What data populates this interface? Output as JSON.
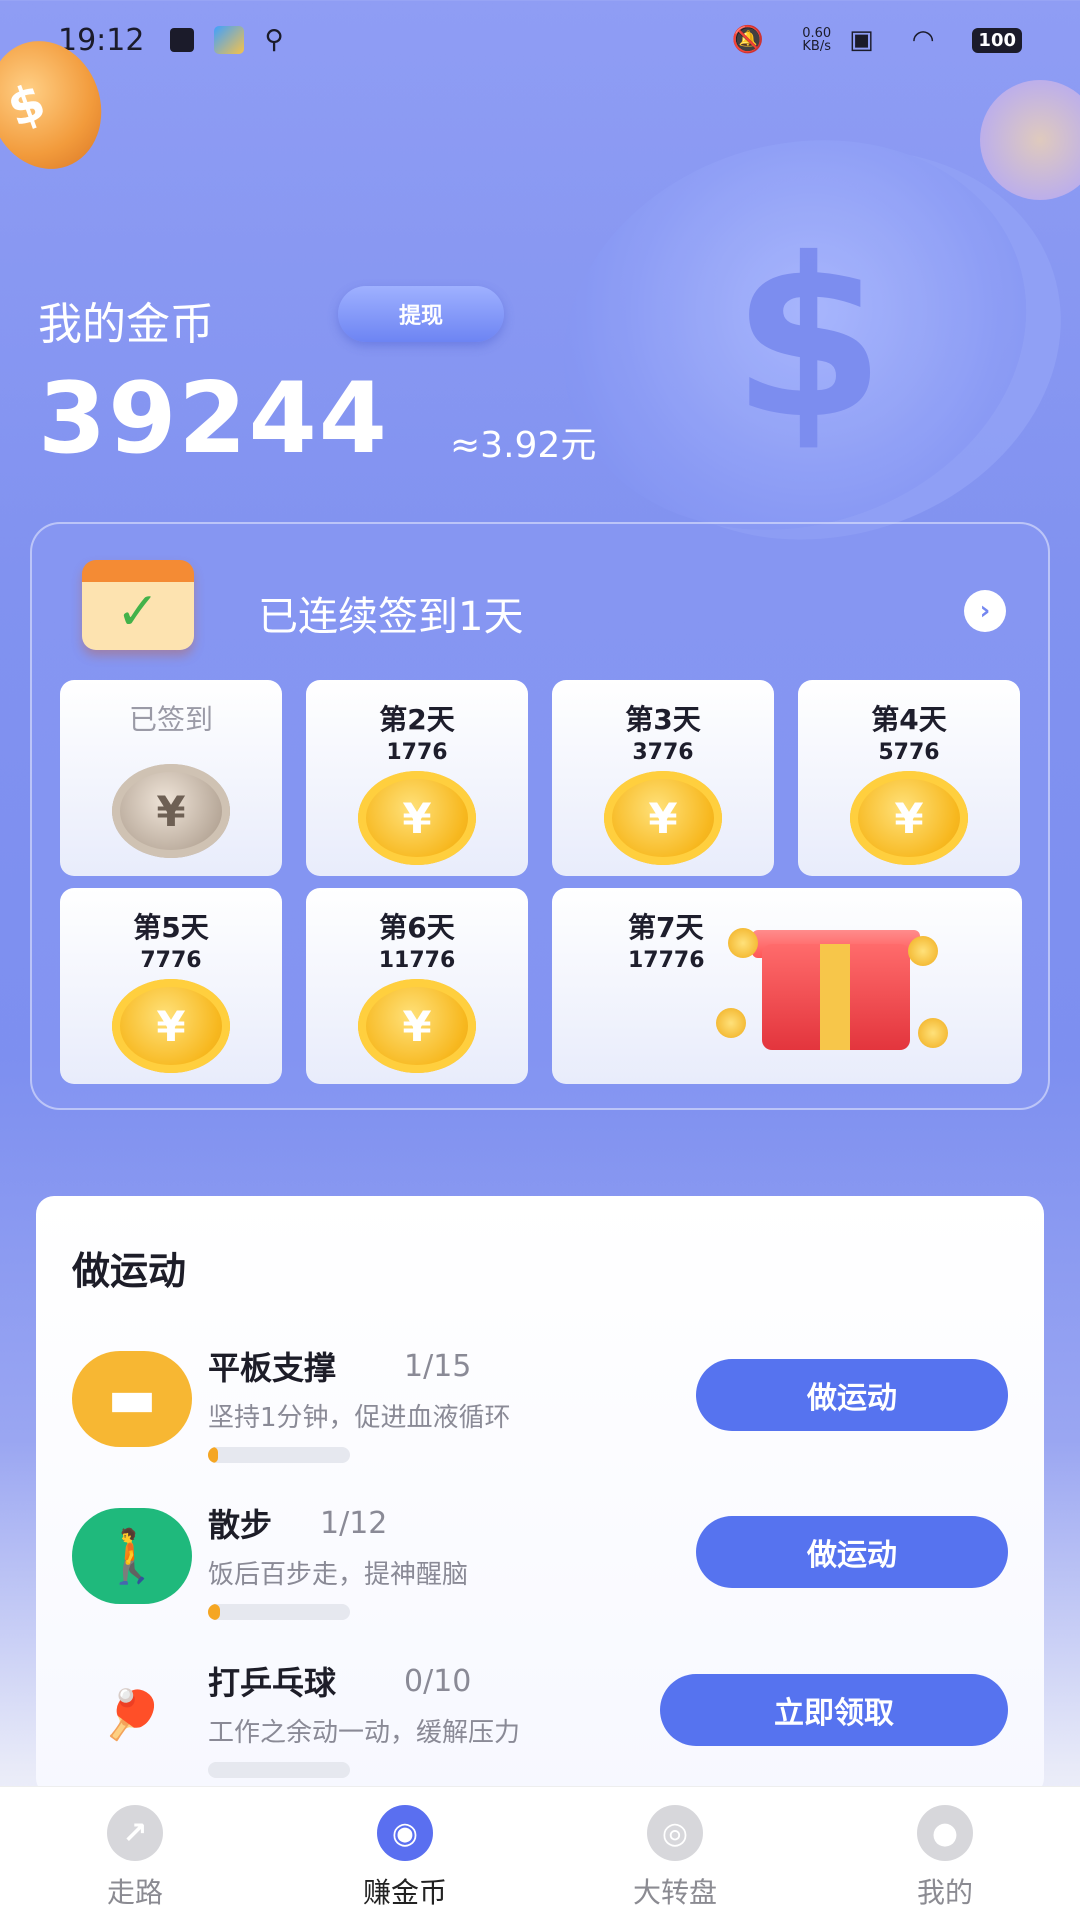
{
  "status_bar": {
    "time": "19:12",
    "net_speed_value": "0.60",
    "net_speed_unit": "KB/s",
    "battery": "100"
  },
  "header": {
    "coin_title": "我的金币",
    "withdraw_label": "提现",
    "coin_amount": "39244",
    "coin_value": "≈3.92元"
  },
  "signin": {
    "streak_text": "已连续签到1天",
    "days": [
      {
        "label": "已签到",
        "reward": "",
        "state": "done"
      },
      {
        "label": "第2天",
        "reward": "1776",
        "state": "pending"
      },
      {
        "label": "第3天",
        "reward": "3776",
        "state": "pending"
      },
      {
        "label": "第4天",
        "reward": "5776",
        "state": "pending"
      },
      {
        "label": "第5天",
        "reward": "7776",
        "state": "pending"
      },
      {
        "label": "第6天",
        "reward": "11776",
        "state": "pending"
      },
      {
        "label": "第7天",
        "reward": "17776",
        "state": "pending"
      }
    ],
    "coin_symbol": "¥"
  },
  "exercise": {
    "title": "做运动",
    "items": [
      {
        "name": "平板支撑",
        "count": "1/15",
        "desc": "坚持1分钟，促进血液循环",
        "button": "做运动",
        "progress": 0.067,
        "icon": "plank-icon",
        "color": "#f7b733"
      },
      {
        "name": "散步",
        "count": "1/12",
        "desc": "饭后百步走，提神醒脑",
        "button": "做运动",
        "progress": 0.083,
        "icon": "walking-icon",
        "color": "#1fb97c"
      },
      {
        "name": "打乒乓球",
        "count": "0/10",
        "desc": "工作之余动一动，缓解压力",
        "button": "立即领取",
        "progress": 0,
        "icon": "ping-pong-icon",
        "color": "#5673ef"
      }
    ]
  },
  "bottom_nav": {
    "items": [
      {
        "label": "走路",
        "icon": "running-icon",
        "active": false
      },
      {
        "label": "赚金币",
        "icon": "coin-eye-icon",
        "active": true
      },
      {
        "label": "大转盘",
        "icon": "wheel-icon",
        "active": false
      },
      {
        "label": "我的",
        "icon": "user-icon",
        "active": false
      }
    ]
  },
  "colors": {
    "accent": "#5673ef",
    "background_top": "#8f9df4",
    "coin_gold": "#f7b81f"
  }
}
